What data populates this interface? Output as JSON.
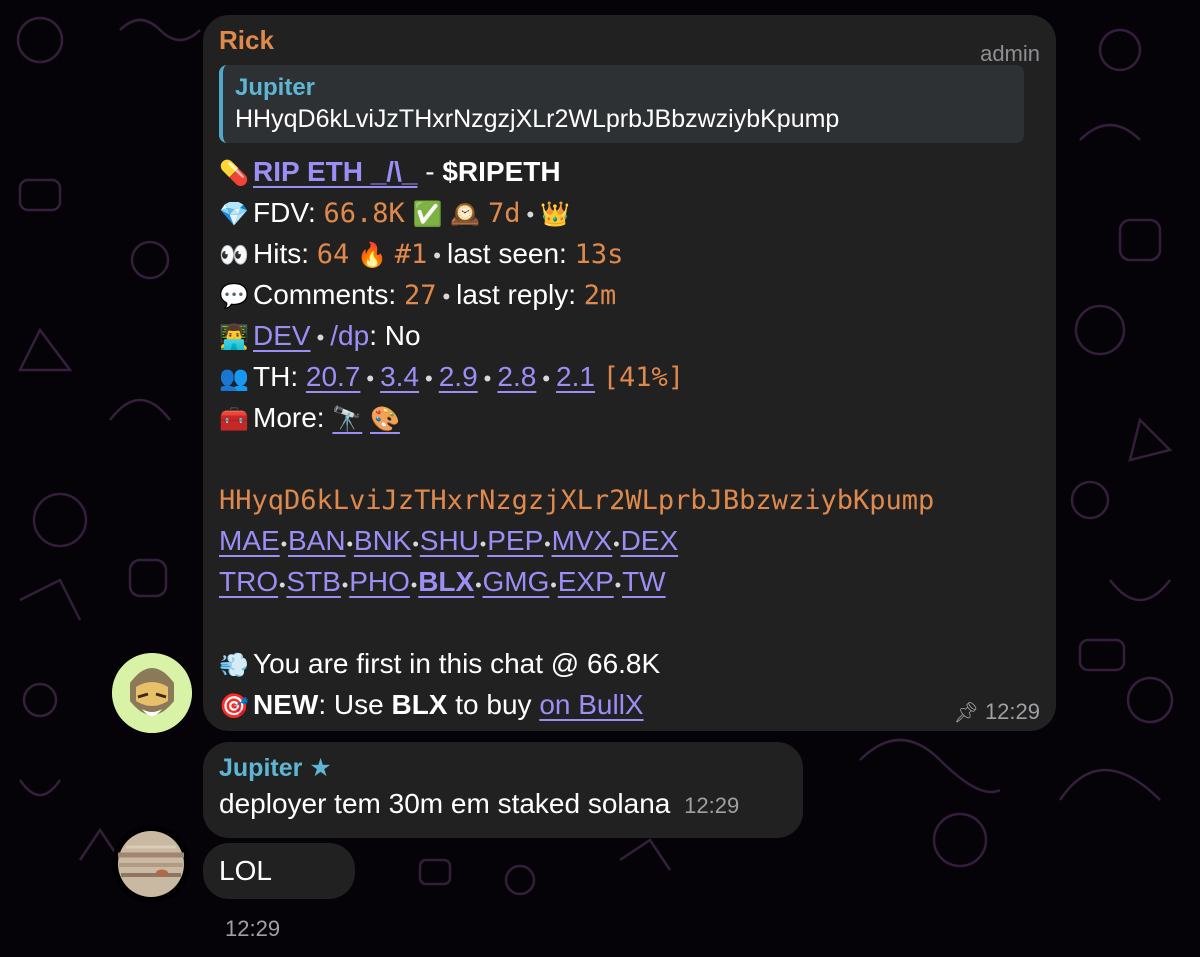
{
  "main_message": {
    "sender": "Rick",
    "role": "admin",
    "quote": {
      "title": "Jupiter",
      "text": "HHyqD6kLviJzTHxrNzgzjXLr2WLprbJBbzwziybKpump"
    },
    "token_line": {
      "emoji": "💊",
      "name": "RIP ETH _/\\_",
      "sep": " - ",
      "ticker": "$RIPETH"
    },
    "fdv_line": {
      "emoji": "💎",
      "label": "FDV: ",
      "value": "66.8K",
      "check": "✅",
      "clock": "🕰️",
      "age": "7d",
      "crown": "👑"
    },
    "hits_line": {
      "emoji": "👀",
      "label": "Hits: ",
      "value": "64",
      "fire": "🔥",
      "rank": "#1",
      "seen_label": "last seen: ",
      "seen_value": "13s"
    },
    "comments_line": {
      "emoji": "💬",
      "label": "Comments: ",
      "value": "27",
      "reply_label": "last reply: ",
      "reply_value": "2m"
    },
    "dev_line": {
      "emoji": "👨‍💻",
      "dev_link": "DEV",
      "dp_label": "/dp",
      "colon": ": ",
      "dp_value": "No"
    },
    "th_line": {
      "emoji": "👥",
      "label": "TH: ",
      "values": [
        "20.7",
        "3.4",
        "2.9",
        "2.8",
        "2.1"
      ],
      "pct": "[41%]"
    },
    "more_line": {
      "emoji": "🧰",
      "label": "More: ",
      "link1": "🔭",
      "link2": "🎨"
    },
    "contract": "HHyqD6kLviJzTHxrNzgzjXLr2WLprbJBbzwziybKpump",
    "links_row1": [
      "MAE",
      "BAN",
      "BNK",
      "SHU",
      "PEP",
      "MVX",
      "DEX"
    ],
    "links_row2": [
      "TRO",
      "STB",
      "PHO",
      "BLX",
      "GMG",
      "EXP",
      "TW"
    ],
    "first_line": {
      "emoji": "💨",
      "text": "You are first in this chat @ 66.8K"
    },
    "new_line": {
      "emoji": "🎯",
      "new_label": "NEW",
      "colon": ": Use ",
      "blx": "BLX",
      "mid": " to buy ",
      "link": "on BullX"
    },
    "time": "12:29",
    "pin_icon": "pin-icon"
  },
  "reply_message": {
    "sender": "Jupiter",
    "star": "★",
    "text": "deployer tem 30m em staked solana",
    "time": "12:29"
  },
  "lol_message": {
    "text": "LOL",
    "time": "12:29"
  },
  "colors": {
    "accent_orange": "#e0894c",
    "link_purple": "#9b8ef6",
    "name_blue": "#5eb6d4",
    "bubble": "#212121",
    "background": "#050308"
  }
}
